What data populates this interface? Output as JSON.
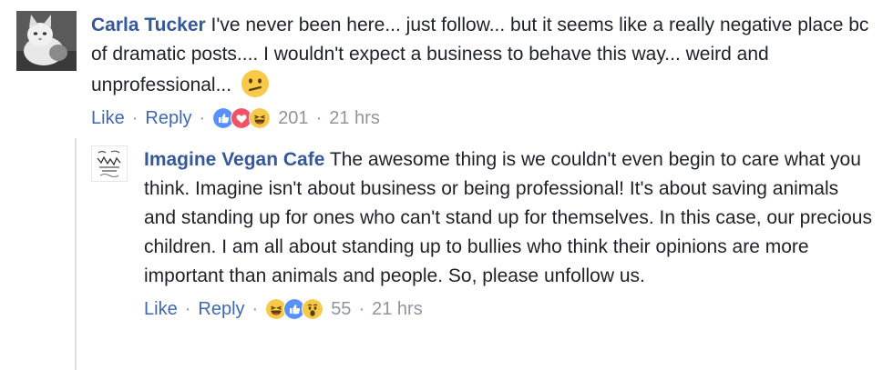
{
  "comments": [
    {
      "author": "Carla Tucker",
      "text": "I've never been here... just follow... but it seems like a really negative place bc of dramatic posts.... I wouldn't expect a business to behave this way... weird and unprofessional...",
      "inline_emoji": "confused-face",
      "actions": {
        "like": "Like",
        "separator": "·",
        "reply": "Reply",
        "reaction_icons": [
          "like-icon",
          "heart-icon",
          "haha-icon"
        ],
        "reaction_count": "201",
        "time": "21 hrs"
      },
      "avatar": "cat-avatar"
    },
    {
      "author": "Imagine Vegan Cafe",
      "text": "The awesome thing is we couldn't even begin to care what you think. Imagine isn't about business or being professional! It's about saving animals and standing up for ones who can't stand up for themselves. In this case, our precious children. I am all about standing up to bullies who think their opinions are more important than animals and people. So, please unfollow us.",
      "actions": {
        "like": "Like",
        "separator": "·",
        "reply": "Reply",
        "reaction_icons": [
          "haha-icon",
          "like-icon",
          "wow-icon"
        ],
        "reaction_count": "55",
        "time": "21 hrs"
      },
      "avatar": "cafe-logo-avatar"
    }
  ],
  "colors": {
    "author_link": "#365899",
    "action_link": "#4267b2",
    "meta_gray": "#90949c",
    "like_blue": "#5890ff",
    "heart_red": "#f25268",
    "emoji_yellow": "#f7c948"
  }
}
